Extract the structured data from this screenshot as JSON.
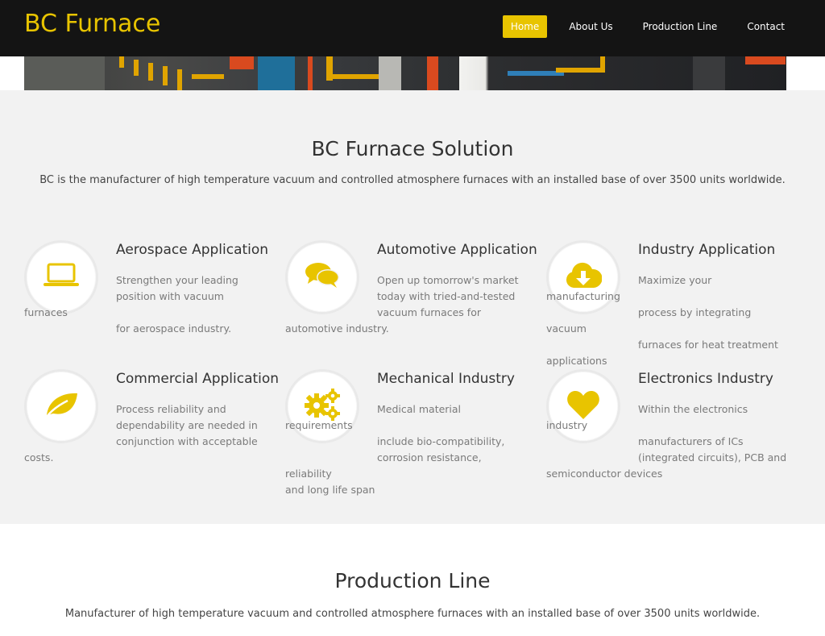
{
  "brand": "BC Furnace",
  "nav": {
    "items": [
      {
        "label": "Home",
        "active": true
      },
      {
        "label": "About Us",
        "active": false
      },
      {
        "label": "Production Line",
        "active": false
      },
      {
        "label": "Contact",
        "active": false
      }
    ]
  },
  "colors": {
    "accent": "#e8c400",
    "header_bg": "#141414",
    "section_bg": "#f2f2f2"
  },
  "solution": {
    "title": "BC Furnace Solution",
    "subtitle": "BC is the manufacturer of high temperature vacuum and controlled atmosphere furnaces with an installed base of over 3500 units worldwide.",
    "features": [
      {
        "icon": "laptop-icon",
        "title": "Aerospace Application",
        "lines": [
          "Strengthen your leading",
          "position with vacuum furnaces",
          "for aerospace industry."
        ]
      },
      {
        "icon": "chat-bubbles-icon",
        "title": "Automotive Application",
        "lines": [
          "Open up tomorrow's market",
          "today with tried-and-tested",
          "vacuum furnaces for",
          "automotive industry."
        ]
      },
      {
        "icon": "cloud-download-icon",
        "title": "Industry Application",
        "lines": [
          "Maximize your manufacturing",
          "process by integrating vacuum",
          "furnaces for heat treatment",
          "applications"
        ]
      },
      {
        "icon": "leaf-icon",
        "title": "Commercial Application",
        "lines": [
          "Process reliability and",
          "dependability are needed in",
          "conjunction with acceptable",
          "costs."
        ]
      },
      {
        "icon": "gears-icon",
        "title": "Mechanical Industry",
        "lines": [
          "Medical material requirements",
          "include bio-compatibility,",
          "corrosion resistance, reliability",
          "and long life span"
        ]
      },
      {
        "icon": "heart-icon",
        "title": "Electronics Industry",
        "lines": [
          "Within the electronics industry",
          "manufacturers of ICs",
          "(integrated circuits), PCB and",
          "semiconductor devices"
        ]
      }
    ]
  },
  "production": {
    "title": "Production Line",
    "subtitle": "Manufacturer of high temperature vacuum and controlled atmosphere furnaces with an installed base of over 3500 units worldwide."
  }
}
